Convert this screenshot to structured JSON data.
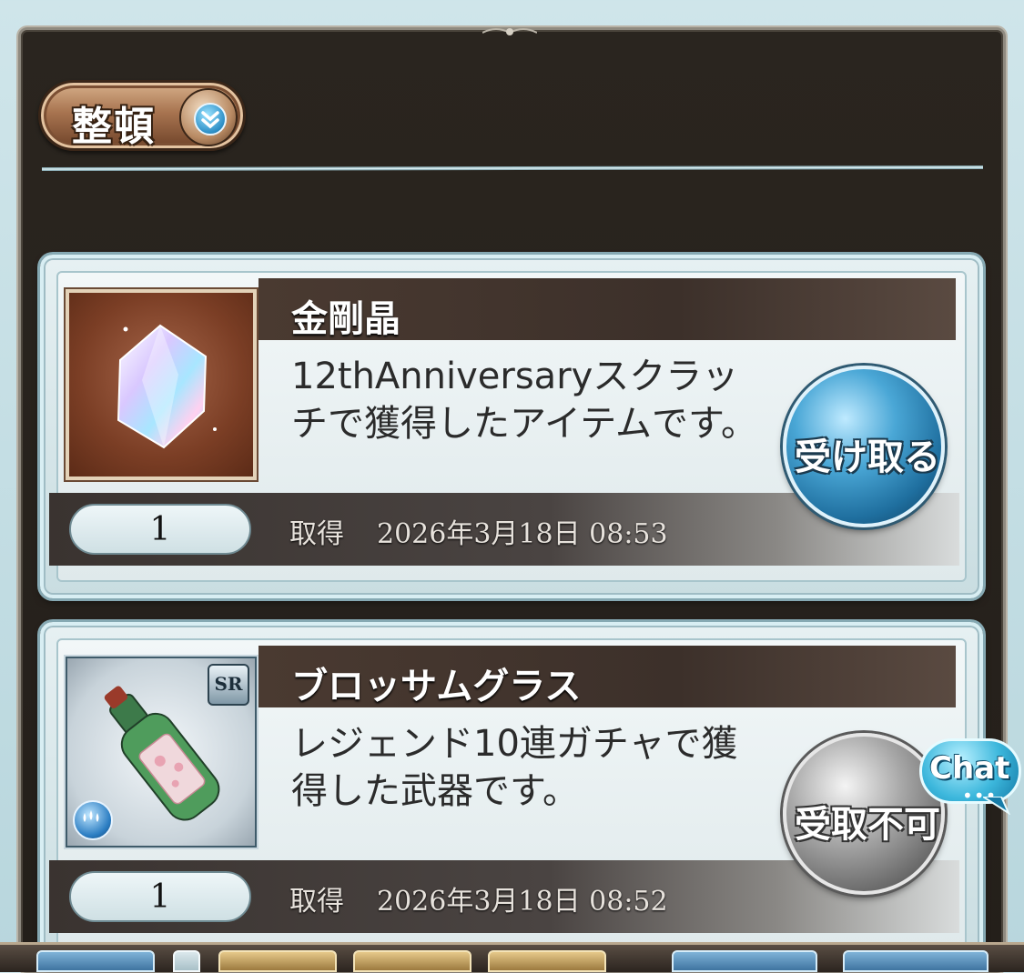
{
  "toolbar": {
    "sort_label": "整頓",
    "sort_icon": "double-chevron-down-icon"
  },
  "items": [
    {
      "name": "金剛晶",
      "description": "12thAnniversaryスクラッチで獲得したアイテムです。",
      "quantity": "1",
      "acquired_label": "取得",
      "acquired_date": "2026年3月18日 08:53",
      "action_label": "受け取る",
      "action_enabled": true,
      "thumbnail_icon": "crystal-icon"
    },
    {
      "name": "ブロッサムグラス",
      "description": "レジェンド10連ガチャで獲得した武器です。",
      "quantity": "1",
      "acquired_label": "取得",
      "acquired_date": "2026年3月18日 08:52",
      "action_label": "受取不可",
      "action_enabled": false,
      "thumbnail_icon": "bottle-icon",
      "rarity": "SR",
      "element_icon": "water-element-icon"
    }
  ],
  "chat": {
    "label": "Chat",
    "dots": "•••"
  },
  "colors": {
    "panel_bg": "#241f1a",
    "card_border": "#d8eef3",
    "active_button": "#1f6f9f",
    "disabled_button": "#6b6b6b"
  }
}
